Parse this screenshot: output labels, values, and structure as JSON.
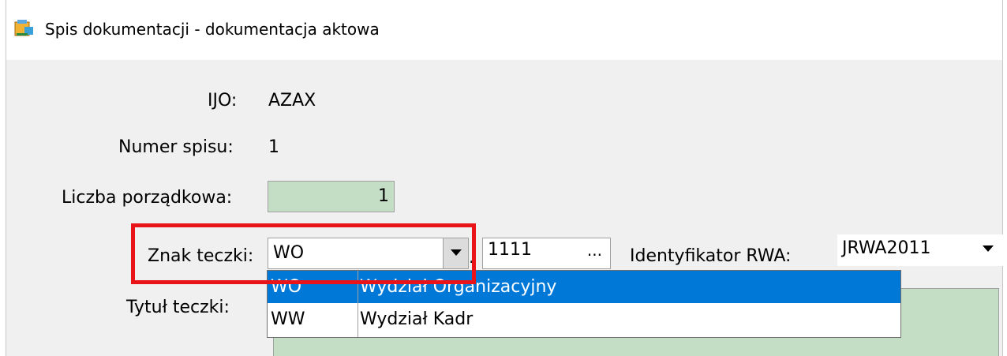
{
  "window": {
    "title": "Spis dokumentacji - dokumentacja aktowa",
    "icon": "folder-app-icon"
  },
  "form": {
    "ijo_label": "IJO:",
    "ijo_value": "AZAX",
    "numer_spisu_label": "Numer spisu:",
    "numer_spisu_value": "1",
    "liczba_label": "Liczba porządkowa:",
    "liczba_value": "1",
    "znak_label": "Znak teczki:",
    "znak_value": "WO",
    "separator": ".",
    "rwa_code": "1111",
    "rwa_browse": "...",
    "rwa_id_label": "Identyfikator RWA:",
    "rwa_id_value": "JRWA2011",
    "tytul_label": "Tytuł teczki:"
  },
  "dropdown": {
    "options": [
      {
        "code": "WO",
        "name": "Wydział Organizacyjny",
        "selected": true
      },
      {
        "code": "WW",
        "name": "Wydział Kadr",
        "selected": false
      }
    ]
  },
  "colors": {
    "field_green": "#c3dec4",
    "selection_blue": "#0078d7",
    "highlight_red": "#e8141a"
  }
}
